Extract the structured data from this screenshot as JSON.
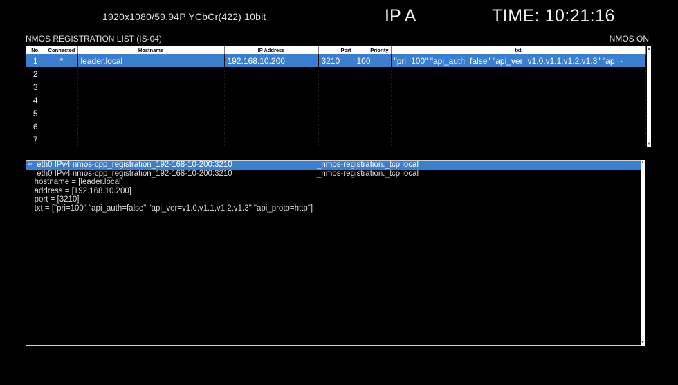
{
  "header": {
    "format": "1920x1080/59.94P YCbCr(422) 10bit",
    "ip": "IP A",
    "time": "TIME: 10:21:16"
  },
  "list": {
    "title": "NMOS REGISTRATION LIST (IS-04)",
    "status": "NMOS ON",
    "columns": [
      "No.",
      "Connected",
      "Hostname",
      "IP Address",
      "Port",
      "Priority",
      "txt"
    ],
    "rows": [
      {
        "no": "1",
        "connected": "*",
        "hostname": "leader.local",
        "ip": "192.168.10.200",
        "port": "3210",
        "priority": "100",
        "txt": "\"pri=100\" \"api_auth=false\" \"api_ver=v1.0,v1.1,v1.2,v1.3\" \"ap···"
      },
      {
        "no": "2",
        "connected": "",
        "hostname": "",
        "ip": "",
        "port": "",
        "priority": "",
        "txt": ""
      },
      {
        "no": "3",
        "connected": "",
        "hostname": "",
        "ip": "",
        "port": "",
        "priority": "",
        "txt": ""
      },
      {
        "no": "4",
        "connected": "",
        "hostname": "",
        "ip": "",
        "port": "",
        "priority": "",
        "txt": ""
      },
      {
        "no": "5",
        "connected": "",
        "hostname": "",
        "ip": "",
        "port": "",
        "priority": "",
        "txt": ""
      },
      {
        "no": "6",
        "connected": "",
        "hostname": "",
        "ip": "",
        "port": "",
        "priority": "",
        "txt": ""
      },
      {
        "no": "7",
        "connected": "",
        "hostname": "",
        "ip": "",
        "port": "",
        "priority": "",
        "txt": ""
      }
    ]
  },
  "detail": {
    "lines": [
      {
        "text": "+  eth0 IPv4 nmos-cpp_registration_192-168-10-200:3210",
        "service": "_nmos-registration._tcp local",
        "selected": true
      },
      {
        "text": "=  eth0 IPv4 nmos-cpp_registration_192-168-10-200:3210",
        "service": "_nmos-registration._tcp local",
        "selected": false
      },
      {
        "text": "   hostname = [leader.local]",
        "service": "",
        "selected": false
      },
      {
        "text": "   address = [192.168.10.200]",
        "service": "",
        "selected": false
      },
      {
        "text": "   port = [3210]",
        "service": "",
        "selected": false
      },
      {
        "text": "   txt = [\"pri=100\" \"api_auth=false\" \"api_ver=v1.0,v1.1,v1.2,v1.3\" \"api_proto=http\"]",
        "service": "",
        "selected": false
      }
    ]
  },
  "colors": {
    "selection": "#3b7fd0",
    "background": "#000000",
    "text": "#e6e6e6"
  }
}
